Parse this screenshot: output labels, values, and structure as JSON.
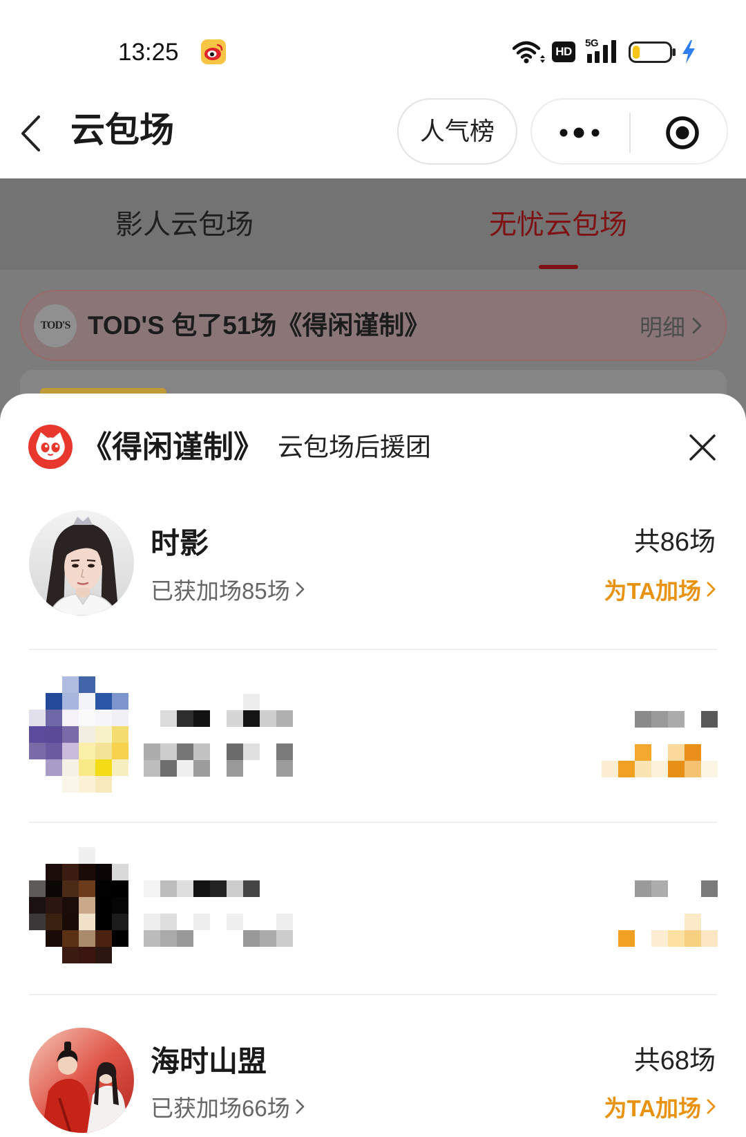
{
  "status_bar": {
    "time": "13:25",
    "app_notification_icon": "weibo-icon",
    "wifi_icon": "wifi-icon",
    "hd_badge": "HD",
    "network_type": "5G",
    "signal_icon": "signal-bars-icon",
    "battery_icon": "battery-icon",
    "battery_level": 0.2,
    "charging_icon": "charging-bolt-icon"
  },
  "nav": {
    "back_icon": "chevron-left-icon",
    "title": "云包场",
    "ranking_button_label": "人气榜",
    "more_icon": "more-dots-icon",
    "exit_icon": "target-circle-icon"
  },
  "tabs": [
    {
      "label": "影人云包场",
      "active": false
    },
    {
      "label": "无忧云包场",
      "active": true
    }
  ],
  "banner": {
    "logo_text": "TOD'S",
    "text": "TOD'S 包了51场《得闲谨制》",
    "detail_label": "明细",
    "detail_icon": "chevron-right-icon"
  },
  "sheet": {
    "logo_icon": "maoyan-cat-icon",
    "title": "《得闲谨制》",
    "subtitle": "云包场后援团",
    "close_icon": "close-icon",
    "groups": [
      {
        "name": "时影",
        "extra_label": "已获加场85场",
        "total_label": "共86场",
        "action_label": "为TA加场",
        "pixelated": false
      },
      {
        "pixelated": true
      },
      {
        "pixelated": true
      },
      {
        "name": "海时山盟",
        "extra_label": "已获加场66场",
        "total_label": "共68场",
        "action_label": "为TA加场",
        "pixelated": false
      }
    ]
  },
  "colors": {
    "accent_red": "#7d1114",
    "action_orange": "#e8920f",
    "brand_red": "#e8372c",
    "text_primary": "#1a1a1a",
    "text_secondary": "#666666",
    "battery_fill": "#f5c518",
    "charging_blue": "#2f7ff0"
  }
}
